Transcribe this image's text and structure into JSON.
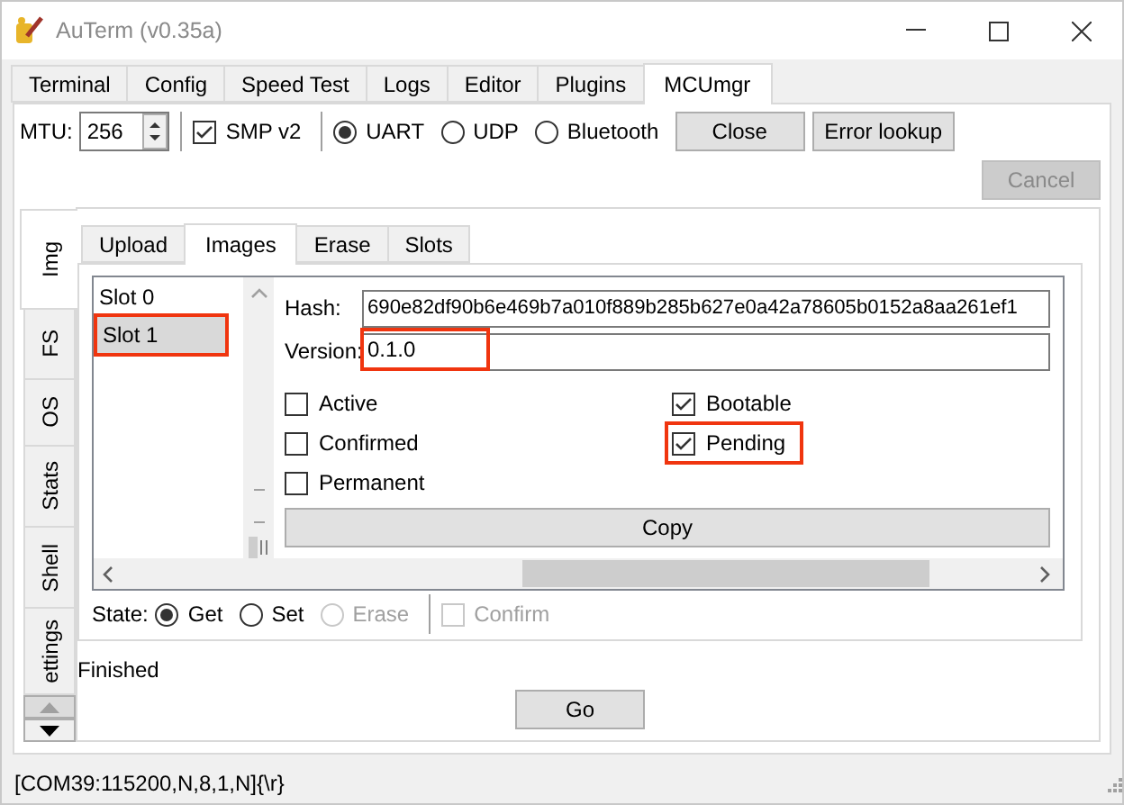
{
  "window": {
    "title": "AuTerm (v0.35a)"
  },
  "tabs": [
    {
      "label": "Terminal",
      "selected": false
    },
    {
      "label": "Config",
      "selected": false
    },
    {
      "label": "Speed Test",
      "selected": false
    },
    {
      "label": "Logs",
      "selected": false
    },
    {
      "label": "Editor",
      "selected": false
    },
    {
      "label": "Plugins",
      "selected": false
    },
    {
      "label": "MCUmgr",
      "selected": true
    }
  ],
  "toolbar": {
    "mtu_label": "MTU:",
    "mtu_value": "256",
    "smp_v2": {
      "label": "SMP v2",
      "checked": true
    },
    "transports": [
      {
        "label": "UART",
        "selected": true
      },
      {
        "label": "UDP",
        "selected": false
      },
      {
        "label": "Bluetooth",
        "selected": false
      }
    ],
    "buttons": [
      {
        "label": "Close",
        "disabled": false
      },
      {
        "label": "Error lookup",
        "disabled": false
      }
    ]
  },
  "cancel_button": {
    "label": "Cancel",
    "disabled": true
  },
  "side_tabs": [
    {
      "label": "Img",
      "selected": true
    },
    {
      "label": "FS",
      "selected": false
    },
    {
      "label": "OS",
      "selected": false
    },
    {
      "label": "Stats",
      "selected": false
    },
    {
      "label": "Shell",
      "selected": false
    },
    {
      "label": "ettings",
      "selected": false
    }
  ],
  "sub_tabs": [
    {
      "label": "Upload",
      "selected": false
    },
    {
      "label": "Images",
      "selected": true
    },
    {
      "label": "Erase",
      "selected": false
    },
    {
      "label": "Slots",
      "selected": false
    }
  ],
  "slots": [
    {
      "label": "Slot 0",
      "selected": false,
      "highlighted": false
    },
    {
      "label": "Slot 1",
      "selected": true,
      "highlighted": true
    }
  ],
  "hash": {
    "label": "Hash:",
    "value": "690e82df90b6e469b7a010f889b285b627e0a42a78605b0152a8aa261ef1"
  },
  "version": {
    "label": "Version:",
    "value": "0.1.0",
    "highlighted": true
  },
  "flags_left": [
    {
      "label": "Active",
      "checked": false,
      "highlighted": false
    },
    {
      "label": "Confirmed",
      "checked": false,
      "highlighted": false
    },
    {
      "label": "Permanent",
      "checked": false,
      "highlighted": false
    }
  ],
  "flags_right": [
    {
      "label": "Bootable",
      "checked": true,
      "highlighted": false
    },
    {
      "label": "Pending",
      "checked": true,
      "highlighted": true
    }
  ],
  "copy_button": "Copy",
  "state": {
    "label": "State:",
    "options": [
      {
        "label": "Get",
        "selected": true,
        "disabled": false
      },
      {
        "label": "Set",
        "selected": false,
        "disabled": false
      },
      {
        "label": "Erase",
        "selected": false,
        "disabled": true
      }
    ],
    "confirm": {
      "label": "Confirm",
      "checked": false,
      "disabled": true
    }
  },
  "status_message": "Finished",
  "go_button": "Go",
  "status_bar": "[COM39:115200,N,8,1,N]{\\r}"
}
